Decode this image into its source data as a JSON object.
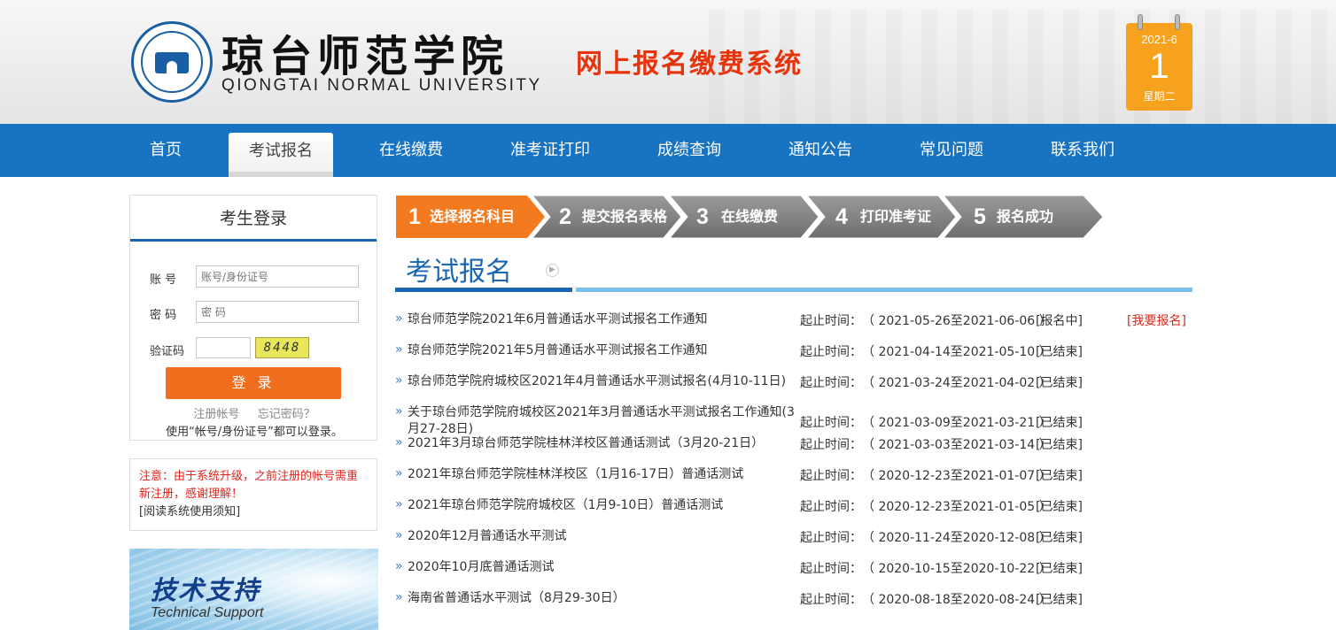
{
  "header": {
    "school_cn": "琼台师范学院",
    "school_en": "QIONGTAI NORMAL UNIVERSITY",
    "system_title": "网上报名缴费系统",
    "calendar": {
      "month": "2021-6",
      "day": "1",
      "weekday": "星期二"
    }
  },
  "nav": {
    "items": [
      {
        "label": "首页"
      },
      {
        "label": "考试报名"
      },
      {
        "label": "在线缴费"
      },
      {
        "label": "准考证打印"
      },
      {
        "label": "成绩查询"
      },
      {
        "label": "通知公告"
      },
      {
        "label": "常见问题"
      },
      {
        "label": "联系我们"
      }
    ],
    "active": "考试报名"
  },
  "login": {
    "title": "考生登录",
    "account_label": "账  号",
    "account_placeholder": "账号/身份证号",
    "password_label": "密  码",
    "password_placeholder": "密 码",
    "captcha_label": "验证码",
    "captcha_text": "8448",
    "login_button": "登 录",
    "register_link": "注册帐号",
    "forgot_link": "忘记密码？",
    "hint": "使用“帐号/身份证号”都可以登录。"
  },
  "notice": {
    "text": "注意：由于系统升级，之前注册的帐号需重新注册，感谢理解！",
    "link": "[阅读系统使用须知]"
  },
  "support": {
    "title_cn": "技术支持",
    "title_en": "Technical Support"
  },
  "steps": [
    {
      "num": "1",
      "label": "选择报名科目",
      "active": true
    },
    {
      "num": "2",
      "label": "提交报名表格",
      "active": false
    },
    {
      "num": "3",
      "label": "在线缴费",
      "active": false
    },
    {
      "num": "4",
      "label": "打印准考证",
      "active": false
    },
    {
      "num": "5",
      "label": "报名成功",
      "active": false
    }
  ],
  "section_title": "考试报名",
  "period_label": "起止时间：",
  "exams": [
    {
      "title": "琼台师范学院2021年6月普通话水平测试报名工作通知",
      "period": "（ 2021-05-26至2021-06-06 ）",
      "status": "[报名中]",
      "action": "[我要报名]"
    },
    {
      "title": "琼台师范学院2021年5月普通话水平测试报名工作通知",
      "period": "（ 2021-04-14至2021-05-10 ）",
      "status": "[已结束]",
      "action": ""
    },
    {
      "title": "琼台师范学院府城校区2021年4月普通话水平测试报名(4月10-11日)",
      "period": "（ 2021-03-24至2021-04-02 ）",
      "status": "[已结束]",
      "action": ""
    },
    {
      "title": "关于琼台师范学院府城校区2021年3月普通话水平测试报名工作通知(3月27-28日)",
      "period": "（ 2021-03-09至2021-03-21 ）",
      "status": "[已结束]",
      "action": ""
    },
    {
      "title": "2021年3月琼台师范学院桂林洋校区普通话测试（3月20-21日）",
      "period": "（ 2021-03-03至2021-03-14 ）",
      "status": "[已结束]",
      "action": ""
    },
    {
      "title": "2021年琼台师范学院桂林洋校区（1月16-17日）普通话测试",
      "period": "（ 2020-12-23至2021-01-07 ）",
      "status": "[已结束]",
      "action": ""
    },
    {
      "title": "2021年琼台师范学院府城校区（1月9-10日）普通话测试",
      "period": "（ 2020-12-23至2021-01-05 ）",
      "status": "[已结束]",
      "action": ""
    },
    {
      "title": "2020年12月普通话水平测试",
      "period": "（ 2020-11-24至2020-12-08 ）",
      "status": "[已结束]",
      "action": ""
    },
    {
      "title": "2020年10月底普通话测试",
      "period": "（ 2020-10-15至2020-10-22 ）",
      "status": "[已结束]",
      "action": ""
    },
    {
      "title": "海南省普通话水平测试（8月29-30日）",
      "period": "（ 2020-08-18至2020-08-24 ）",
      "status": "[已结束]",
      "action": ""
    }
  ],
  "colors": {
    "nav_blue": "#1874c2",
    "step_active": "#f47a20",
    "step_inactive": "#8a8a8a",
    "accent_red": "#e0251b"
  }
}
